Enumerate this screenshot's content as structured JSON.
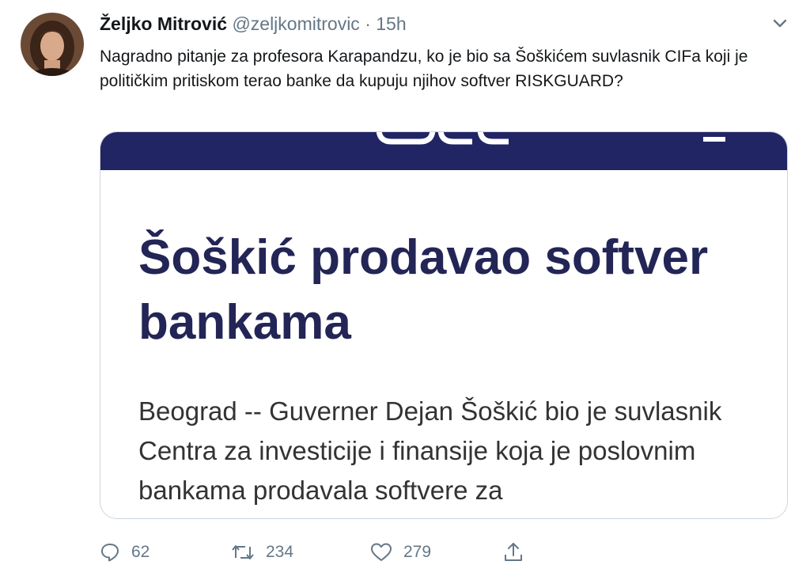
{
  "tweet": {
    "author_name": "Željko Mitrović",
    "handle": "@zeljkomitrovic",
    "separator": "·",
    "time": "15h",
    "text": "Nagradno pitanje za profesora Karapandzu, ko je bio sa Šoškićem suvlasnik CIFa koji je političkim pritiskom terao banke da kupuju njihov softver RISKGUARD?",
    "avatar_icon": "user-avatar",
    "more_icon": "chevron-down-icon"
  },
  "card": {
    "banner_color": "#212564",
    "title": "Šoškić prodavao softver bankama",
    "body": "Beograd -- Guverner Dejan Šoškić bio je suvlasnik Centra za investicije i finansije koja je poslovnim bankama prodavala softvere za"
  },
  "actions": {
    "reply_count": "62",
    "retweet_count": "234",
    "like_count": "279",
    "icons": [
      "reply-icon",
      "retweet-icon",
      "like-icon",
      "share-icon"
    ]
  }
}
